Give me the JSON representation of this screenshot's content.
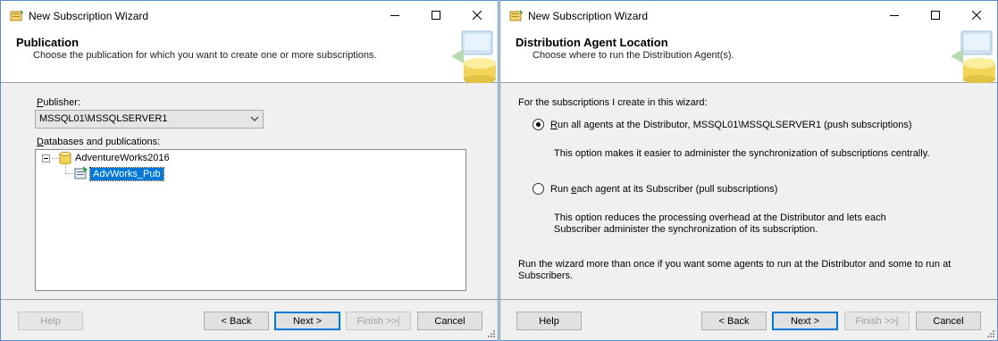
{
  "wizard1": {
    "title": "New Subscription Wizard",
    "header_title": "Publication",
    "header_subtitle": "Choose the publication for which you want to create one or more subscriptions.",
    "publisher_label": "Publisher:",
    "publisher_value": "MSSQL01\\MSSQLSERVER1",
    "tree_label": "Databases and publications:",
    "tree_database": "AdventureWorks2016",
    "tree_publication": "AdvWorks_Pub",
    "buttons": {
      "help": "Help",
      "back": "< Back",
      "next": "Next >",
      "finish": "Finish >>|",
      "cancel": "Cancel"
    }
  },
  "wizard2": {
    "title": "New Subscription Wizard",
    "header_title": "Distribution Agent Location",
    "header_subtitle": "Choose where to run the Distribution Agent(s).",
    "intro": "For the subscriptions I create in this wizard:",
    "option1_label": "Run all agents at the Distributor, MSSQL01\\MSSQLSERVER1 (push subscriptions)",
    "option1_desc": "This option makes it easier to administer the synchronization of subscriptions centrally.",
    "option2_label": "Run each agent at its Subscriber (pull subscriptions)",
    "option2_desc_line1": "This option reduces the processing overhead at the Distributor and lets each",
    "option2_desc_line2": "Subscriber administer the synchronization of its subscription.",
    "note_line1": "Run the wizard more than once if you want some agents to run at the Distributor and some to run at",
    "note_line2": "Subscribers.",
    "buttons": {
      "help": "Help",
      "back": "< Back",
      "next": "Next >",
      "finish": "Finish >>|",
      "cancel": "Cancel"
    }
  },
  "colors": {
    "accent": "#0078d7",
    "window_border": "#5a8fc8",
    "header_bg": "#ffffff",
    "dialog_bg": "#f0f0f0"
  },
  "icons": [
    "wizard-app-icon",
    "minimize-icon",
    "maximize-icon",
    "close-icon",
    "header-database-graphic",
    "database-icon",
    "publication-icon",
    "chevron-down-icon",
    "resize-grip-icon"
  ]
}
